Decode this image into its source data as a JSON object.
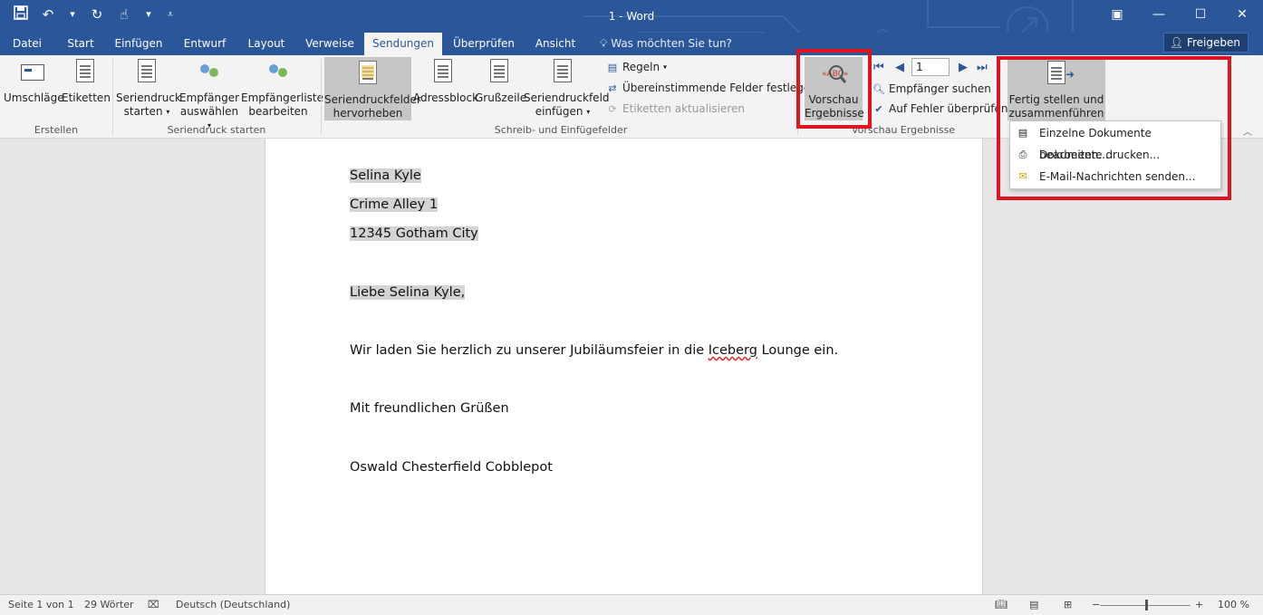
{
  "titlebar": {
    "title": "1 - Word",
    "qat": {
      "save_icon": "save-icon",
      "undo_icon": "undo-icon",
      "redo_icon": "redo-icon",
      "touch_icon": "touch-icon"
    },
    "window": {
      "restore_ribbon": "ribbon-display-icon",
      "minimize": "minimize-icon",
      "maximize": "maximize-icon",
      "close": "close-icon"
    }
  },
  "tabs": [
    {
      "label": "Datei"
    },
    {
      "label": "Start"
    },
    {
      "label": "Einfügen"
    },
    {
      "label": "Entwurf"
    },
    {
      "label": "Layout"
    },
    {
      "label": "Verweise"
    },
    {
      "label": "Sendungen"
    },
    {
      "label": "Überprüfen"
    },
    {
      "label": "Ansicht"
    }
  ],
  "tellme": "Was möchten Sie tun?",
  "share": "Freigeben",
  "ribbon": {
    "erstellen": {
      "umschlaege": "Umschläge",
      "etiketten": "Etiketten",
      "label": "Erstellen"
    },
    "seriendruck": {
      "starten_l1": "Seriendruck",
      "starten_l2": "starten",
      "empfaenger_l1": "Empfänger",
      "empfaenger_l2": "auswählen",
      "liste_l1": "Empfängerliste",
      "liste_l2": "bearbeiten",
      "label": "Seriendruck starten"
    },
    "felder": {
      "hervorheben_l1": "Seriendruckfelder",
      "hervorheben_l2": "hervorheben",
      "adressblock": "Adressblock",
      "grusszeile": "Grußzeile",
      "einfuegen_l1": "Seriendruckfeld",
      "einfuegen_l2": "einfügen",
      "regeln": "Regeln",
      "felder_festlegen": "Übereinstimmende Felder festlegen",
      "etiketten_aktualisieren": "Etiketten aktualisieren",
      "label": "Schreib- und Einfügefelder"
    },
    "vorschau": {
      "btn_l1": "Vorschau",
      "btn_l2": "Ergebnisse",
      "record": "1",
      "suchen": "Empfänger suchen",
      "fehler": "Auf Fehler überprüfen",
      "label": "Vorschau Ergebnisse"
    },
    "fertig": {
      "l1": "Fertig stellen und",
      "l2": "zusammenführen"
    }
  },
  "menu": [
    {
      "label": "Einzelne Dokumente bearbeiten..."
    },
    {
      "label": "Dokumente drucken..."
    },
    {
      "label": "E-Mail-Nachrichten senden..."
    }
  ],
  "document": {
    "name": "Selina Kyle",
    "street": "Crime Alley 1",
    "city": "12345 Gotham City",
    "greeting": "Liebe Selina Kyle,",
    "body_pre": "Wir laden Sie herzlich zu unserer Jubiläumsfeier in die ",
    "body_word": "Iceberg",
    "body_post": " Lounge ein.",
    "closing": "Mit freundlichen Grüßen",
    "signature": "Oswald Chesterfield Cobblepot"
  },
  "status": {
    "page": "Seite 1 von 1",
    "words": "29 Wörter",
    "language": "Deutsch (Deutschland)",
    "zoom_minus": "−",
    "zoom_plus": "+",
    "zoom": "100 %",
    "zoom_percent": 100
  },
  "colors": {
    "brand": "#2b579a",
    "highlight_box": "#e0141e",
    "field_shading": "#d4d4d4"
  }
}
